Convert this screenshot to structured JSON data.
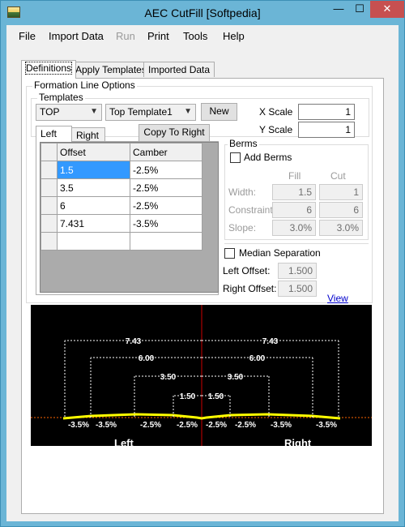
{
  "window": {
    "title": "AEC CutFill [Softpedia]",
    "min_glyph": "—",
    "max_glyph": "☐",
    "close_glyph": "✕"
  },
  "menu": [
    "File",
    "Import Data",
    "Run",
    "Print",
    "Tools",
    "Help"
  ],
  "tabs": [
    "Definitions",
    "Apply Templates",
    "Imported Data"
  ],
  "formation": {
    "group_label": "Formation Line Options",
    "templates_label": "Templates",
    "template_type": "TOP",
    "template_name": "Top Template1",
    "new_label": "New",
    "xscale_label": "X Scale",
    "xscale_value": "1",
    "yscale_label": "Y Scale",
    "yscale_value": "1"
  },
  "side_tabs": [
    "Left",
    "Right"
  ],
  "copy_label": "Copy To Right",
  "grid": {
    "headers": [
      "Offset",
      "Camber"
    ],
    "rows": [
      [
        "1.5",
        "-2.5%"
      ],
      [
        "3.5",
        "-2.5%"
      ],
      [
        "6",
        "-2.5%"
      ],
      [
        "7.431",
        "-3.5%"
      ],
      [
        "",
        ""
      ]
    ]
  },
  "berms": {
    "group_label": "Berms",
    "add_label": "Add Berms",
    "fill_label": "Fill",
    "cut_label": "Cut",
    "width_label": "Width:",
    "width_fill": "1.5",
    "width_cut": "1",
    "constraint_label": "Constraint:",
    "constraint_fill": "6",
    "constraint_cut": "6",
    "slope_label": "Slope:",
    "slope_fill": "3.0%",
    "slope_cut": "3.0%"
  },
  "median": {
    "label": "Median  Separation",
    "left_label": "Left Offset:",
    "left_value": "1.500",
    "right_label": "Right Offset:",
    "right_value": "1.500"
  },
  "view_label": "View",
  "preview": {
    "dims": [
      "7.43",
      "6.00",
      "3.50",
      "1.50"
    ],
    "left_cambers": [
      "-3.5%",
      "-3.5%",
      "-2.5%",
      "-2.5%"
    ],
    "right_cambers": [
      "-2.5%",
      "-2.5%",
      "-3.5%",
      "-3.5%"
    ],
    "left_caption": "Left",
    "right_caption": "Right",
    "colors": {
      "background": "#000000",
      "centerline": "#cc0000",
      "profile": "#ffff00",
      "dimension": "#ffffff",
      "baseline": "#ff6600"
    }
  }
}
